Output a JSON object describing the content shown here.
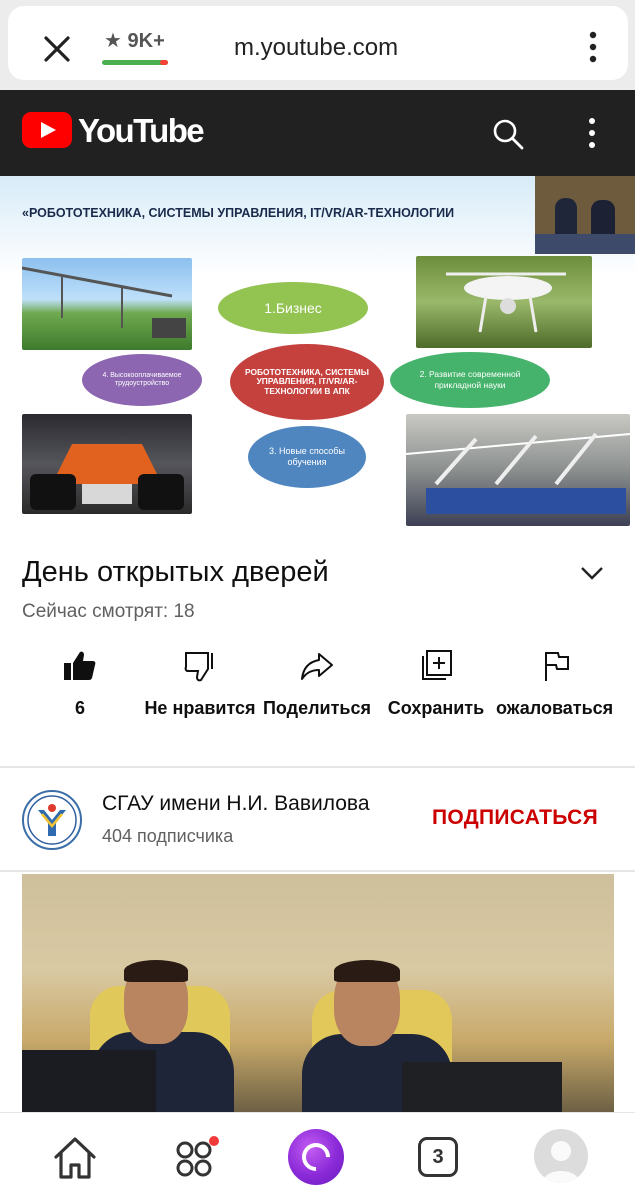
{
  "browser": {
    "rating": "9K+",
    "url": "m.youtube.com"
  },
  "youtube": {
    "wordmark": "YouTube"
  },
  "player": {
    "slide_title": "«РОБОТОТЕХНИКА, СИСТЕМЫ УПРАВЛЕНИЯ,  IT/VR/AR-ТЕХНОЛОГИИ",
    "diagram": {
      "business": "1.Бизнес",
      "center": "РОБОТОТЕХНИКА, СИСТЕМЫ УПРАВЛЕНИЯ, IT/VR/AR-ТЕХНОЛОГИИ В АПК",
      "left": "4. Высокооплачиваемое трудоустройство",
      "right": "2. Развитие современной прикладной науки",
      "bottom": "3. Новые способы обучения"
    }
  },
  "video": {
    "title": "День открытых дверей",
    "viewers": "Сейчас смотрят: 18"
  },
  "actions": {
    "like_count": "6",
    "dislike_label": "Не нравится",
    "share_label": "Поделиться",
    "save_label": "Сохранить",
    "report_label": "ожаловаться"
  },
  "channel": {
    "name": "СГАУ имени Н.И. Вавилова",
    "subscribers": "404 подписчика",
    "subscribe_label": "ПОДПИСАТЬСЯ"
  },
  "bottom_nav": {
    "tabs_count": "3"
  },
  "colors": {
    "youtube_red": "#ff0000",
    "subscribe_red": "#cc0000",
    "header_bg": "#212121",
    "alice_purple": "#8a2ad8"
  }
}
